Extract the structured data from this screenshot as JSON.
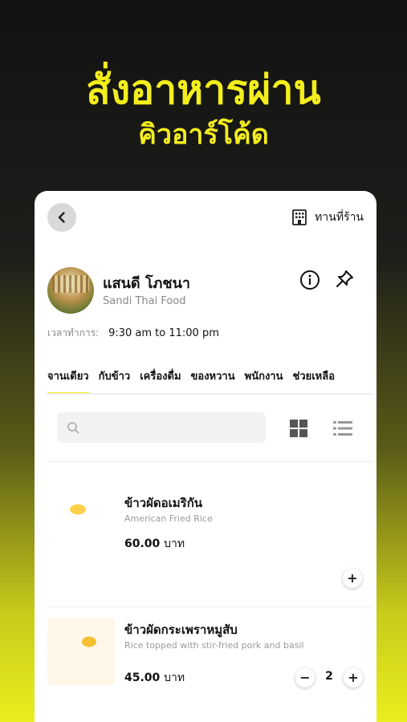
{
  "promo": {
    "headline": "สั่งอาหารผ่าน",
    "subline": "คิวอาร์โค้ด"
  },
  "header": {
    "back_icon": "chevron-left-icon",
    "dine_in_icon": "building-icon",
    "dine_in_label": "ทานที่ร้าน"
  },
  "store": {
    "name": "แสนดี โภชนา",
    "subtitle": "Sandi Thai Food",
    "hours_label": "เวลาทำการ:",
    "hours_value": "9:30 am to 11:00 pm"
  },
  "tabs": [
    {
      "label": "จานเดียว",
      "active": true
    },
    {
      "label": "กับข้าว",
      "active": false
    },
    {
      "label": "เครื่องดื่ม",
      "active": false
    },
    {
      "label": "ของหวาน",
      "active": false
    },
    {
      "label": "พนักงาน",
      "active": false
    },
    {
      "label": "ช่วยเหลือ",
      "active": false
    }
  ],
  "search": {
    "placeholder": ""
  },
  "menu_items": [
    {
      "title": "ข้าวผัดอเมริกัน",
      "subtitle": "American Fried Rice",
      "price": "60.00",
      "unit": "บาท",
      "add_label": "+"
    },
    {
      "title": "ข้าวผัดกระเพราหมูสับ",
      "subtitle": "Rice topped with stir-fried pork and basil",
      "price": "45.00",
      "unit": "บาท",
      "minus_label": "−",
      "quantity": "2",
      "add_label": "+"
    }
  ],
  "colors": {
    "accent": "#f2e81c",
    "text": "#111111",
    "muted": "#888888"
  }
}
